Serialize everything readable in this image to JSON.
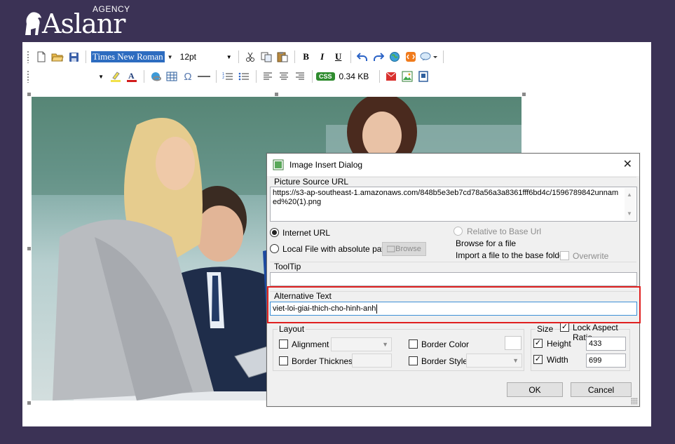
{
  "logo": {
    "brand": "Aslanr",
    "tag": "AGENCY"
  },
  "toolbar1": {
    "font_name": "Times New Roman",
    "font_size": "12pt",
    "bold": "B",
    "italic": "I",
    "underline": "U"
  },
  "toolbar2": {
    "style_value": "",
    "omega": "Ω",
    "css_badge": "CSS",
    "doc_size": "0.34 KB"
  },
  "dialog": {
    "title": "Image Insert Dialog",
    "picture_source_label": "Picture Source URL",
    "url_value": "https://s3-ap-southeast-1.amazonaws.com/848b5e3eb7cd78a56a3a8361fff6bd4c/1596789842unnamed%20(1).png",
    "internet_url_label": "Internet URL",
    "local_file_label": "Local File with absolute path",
    "browse_label": "Browse",
    "relative_label": "Relative to Base Url",
    "browse_for_file_label": "Browse for a file",
    "import_label": "Import a file to the base folder",
    "overwrite_label": "Overwrite",
    "tooltip_label": "ToolTip",
    "tooltip_value": "",
    "alt_text_label": "Alternative Text",
    "alt_text_value": "viet-loi-giai-thich-cho-hinh-anh",
    "layout_label": "Layout",
    "alignment_label": "Alignment",
    "border_thickness_label": "Border Thickness",
    "border_color_label": "Border Color",
    "border_style_label": "Border Style",
    "size_label": "Size",
    "lock_aspect_label": "Lock Aspect Ratio",
    "height_label": "Height",
    "height_value": "433",
    "width_label": "Width",
    "width_value": "699",
    "ok_label": "OK",
    "cancel_label": "Cancel"
  },
  "icons": [
    "new-doc-icon",
    "open-folder-icon",
    "save-icon",
    "cut-icon",
    "copy-icon",
    "paste-icon",
    "undo-icon",
    "redo-icon",
    "globe-icon",
    "html-icon",
    "spell-check-icon",
    "highlight-icon",
    "font-color-icon",
    "link-icon",
    "table-icon",
    "horizontal-rule-icon",
    "numbered-list-icon",
    "bullet-list-icon",
    "align-left-icon",
    "align-center-icon",
    "align-right-icon",
    "email-icon",
    "image-icon",
    "page-icon",
    "close-icon"
  ]
}
